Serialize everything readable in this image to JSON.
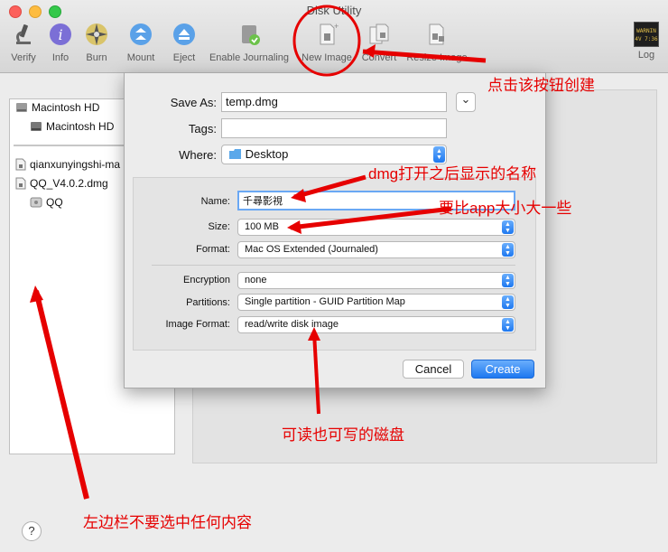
{
  "window": {
    "title": "Disk Utility"
  },
  "toolbar": {
    "items": [
      {
        "label": "Verify",
        "icon": "microscope-icon"
      },
      {
        "label": "Info",
        "icon": "info-icon"
      },
      {
        "label": "Burn",
        "icon": "burn-icon"
      },
      {
        "label": "Mount",
        "icon": "mount-icon"
      },
      {
        "label": "Eject",
        "icon": "eject-icon"
      },
      {
        "label": "Enable Journaling",
        "icon": "journaling-icon"
      },
      {
        "label": "New Image",
        "icon": "new-image-icon"
      },
      {
        "label": "Convert",
        "icon": "convert-icon"
      },
      {
        "label": "Resize Image",
        "icon": "resize-image-icon"
      }
    ],
    "log_label": "Log",
    "log_icon_text": [
      "WARNIN",
      "4V 7:36"
    ]
  },
  "sidebar": {
    "items": [
      {
        "label": "Macintosh HD"
      },
      {
        "label": "Macintosh HD"
      },
      {
        "label": "qianxunyingshi-ma"
      },
      {
        "label": "QQ_V4.0.2.dmg"
      },
      {
        "label": "QQ"
      }
    ]
  },
  "help": "?",
  "sheet": {
    "save_as_label": "Save As:",
    "save_as_value": "temp.dmg",
    "tags_label": "Tags:",
    "tags_value": "",
    "where_label": "Where:",
    "where_value": "Desktop",
    "name_label": "Name:",
    "name_value": "千尋影視",
    "size_label": "Size:",
    "size_value": "100 MB",
    "format_label": "Format:",
    "format_value": "Mac OS Extended (Journaled)",
    "encryption_label": "Encryption",
    "encryption_value": "none",
    "partitions_label": "Partitions:",
    "partitions_value": "Single partition - GUID Partition Map",
    "image_format_label": "Image Format:",
    "image_format_value": "read/write disk image",
    "cancel_label": "Cancel",
    "create_label": "Create",
    "expand_glyph": "⌄"
  },
  "annotations": {
    "click_button": "点击该按钮创建",
    "dmg_name": "dmg打开之后显示的名称",
    "size_hint": "要比app大小大一些",
    "rw_disk": "可读也可写的磁盘",
    "sidebar_hint": "左边栏不要选中任何内容"
  },
  "colors": {
    "accent": "#1e78f0",
    "annotation_red": "#e60000"
  }
}
